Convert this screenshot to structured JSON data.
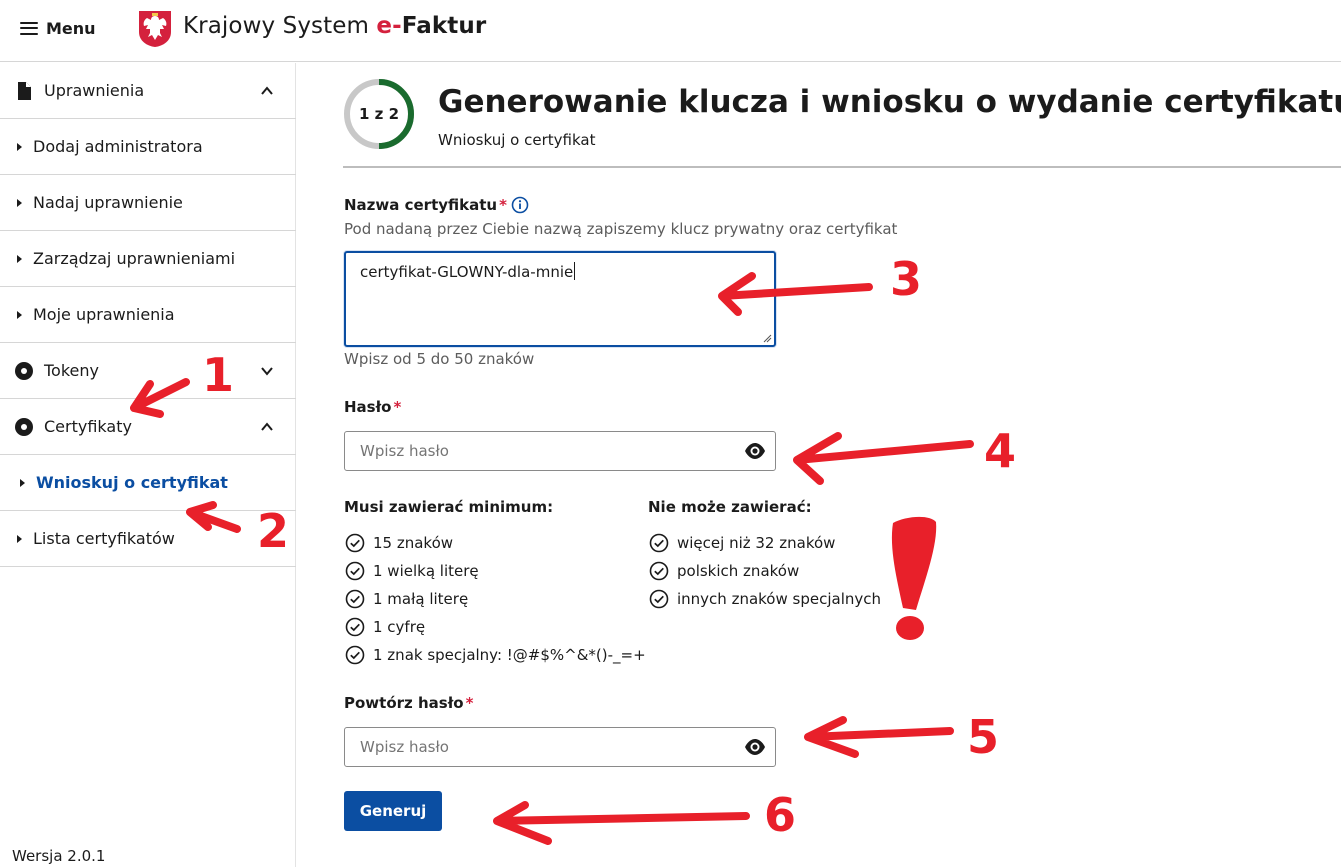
{
  "header": {
    "menu_label": "Menu",
    "brand_prefix": "Krajowy System ",
    "brand_e": "e-",
    "brand_suffix": "Faktur"
  },
  "sidebar": {
    "items": [
      {
        "label": "Uprawnienia",
        "type": "group",
        "expanded": true
      },
      {
        "label": "Dodaj administratora",
        "type": "sub"
      },
      {
        "label": "Nadaj uprawnienie",
        "type": "sub"
      },
      {
        "label": "Zarządzaj uprawnieniami",
        "type": "sub"
      },
      {
        "label": "Moje uprawnienia",
        "type": "sub"
      },
      {
        "label": "Tokeny",
        "type": "group",
        "expanded": false
      },
      {
        "label": "Certyfikaty",
        "type": "group",
        "expanded": true
      },
      {
        "label": "Wnioskuj o certyfikat",
        "type": "sub",
        "active": true
      },
      {
        "label": "Lista certyfikatów",
        "type": "sub"
      }
    ],
    "version": "Wersja 2.0.1"
  },
  "main": {
    "step": {
      "label": "1 z 2",
      "current": 1,
      "total": 2
    },
    "title": "Generowanie klucza i wniosku o wydanie certyfikatu",
    "subtitle": "Wnioskuj o certyfikat",
    "cert_name": {
      "label": "Nazwa certyfikatu",
      "required_mark": "*",
      "description": "Pod nadaną przez Ciebie nazwą zapiszemy klucz prywatny oraz certyfikat",
      "value": "certyfikat-GLOWNY-dla-mnie",
      "hint": "Wpisz od 5 do 50 znaków"
    },
    "password": {
      "label": "Hasło",
      "required_mark": "*",
      "placeholder": "Wpisz hasło"
    },
    "must_contain": {
      "heading": "Musi zawierać minimum:",
      "items": [
        "15 znaków",
        "1 wielką literę",
        "1 małą literę",
        "1 cyfrę",
        "1 znak specjalny: !@#$%^&*()-_=+"
      ]
    },
    "must_not_contain": {
      "heading": "Nie może zawierać:",
      "items": [
        "więcej niż 32 znaków",
        "polskich znaków",
        "innych znaków specjalnych"
      ]
    },
    "repeat_password": {
      "label": "Powtórz hasło",
      "required_mark": "*",
      "placeholder": "Wpisz hasło"
    },
    "submit_label": "Generuj"
  },
  "annotations": {
    "n1": "1",
    "n2": "2",
    "n3": "3",
    "n4": "4",
    "n5": "5",
    "n6": "6",
    "color": "#e8202a"
  },
  "colors": {
    "primary": "#0b4ea2",
    "required": "#d4213d",
    "step_progress": "#1a6b2e",
    "step_track": "#c8c8c8"
  }
}
